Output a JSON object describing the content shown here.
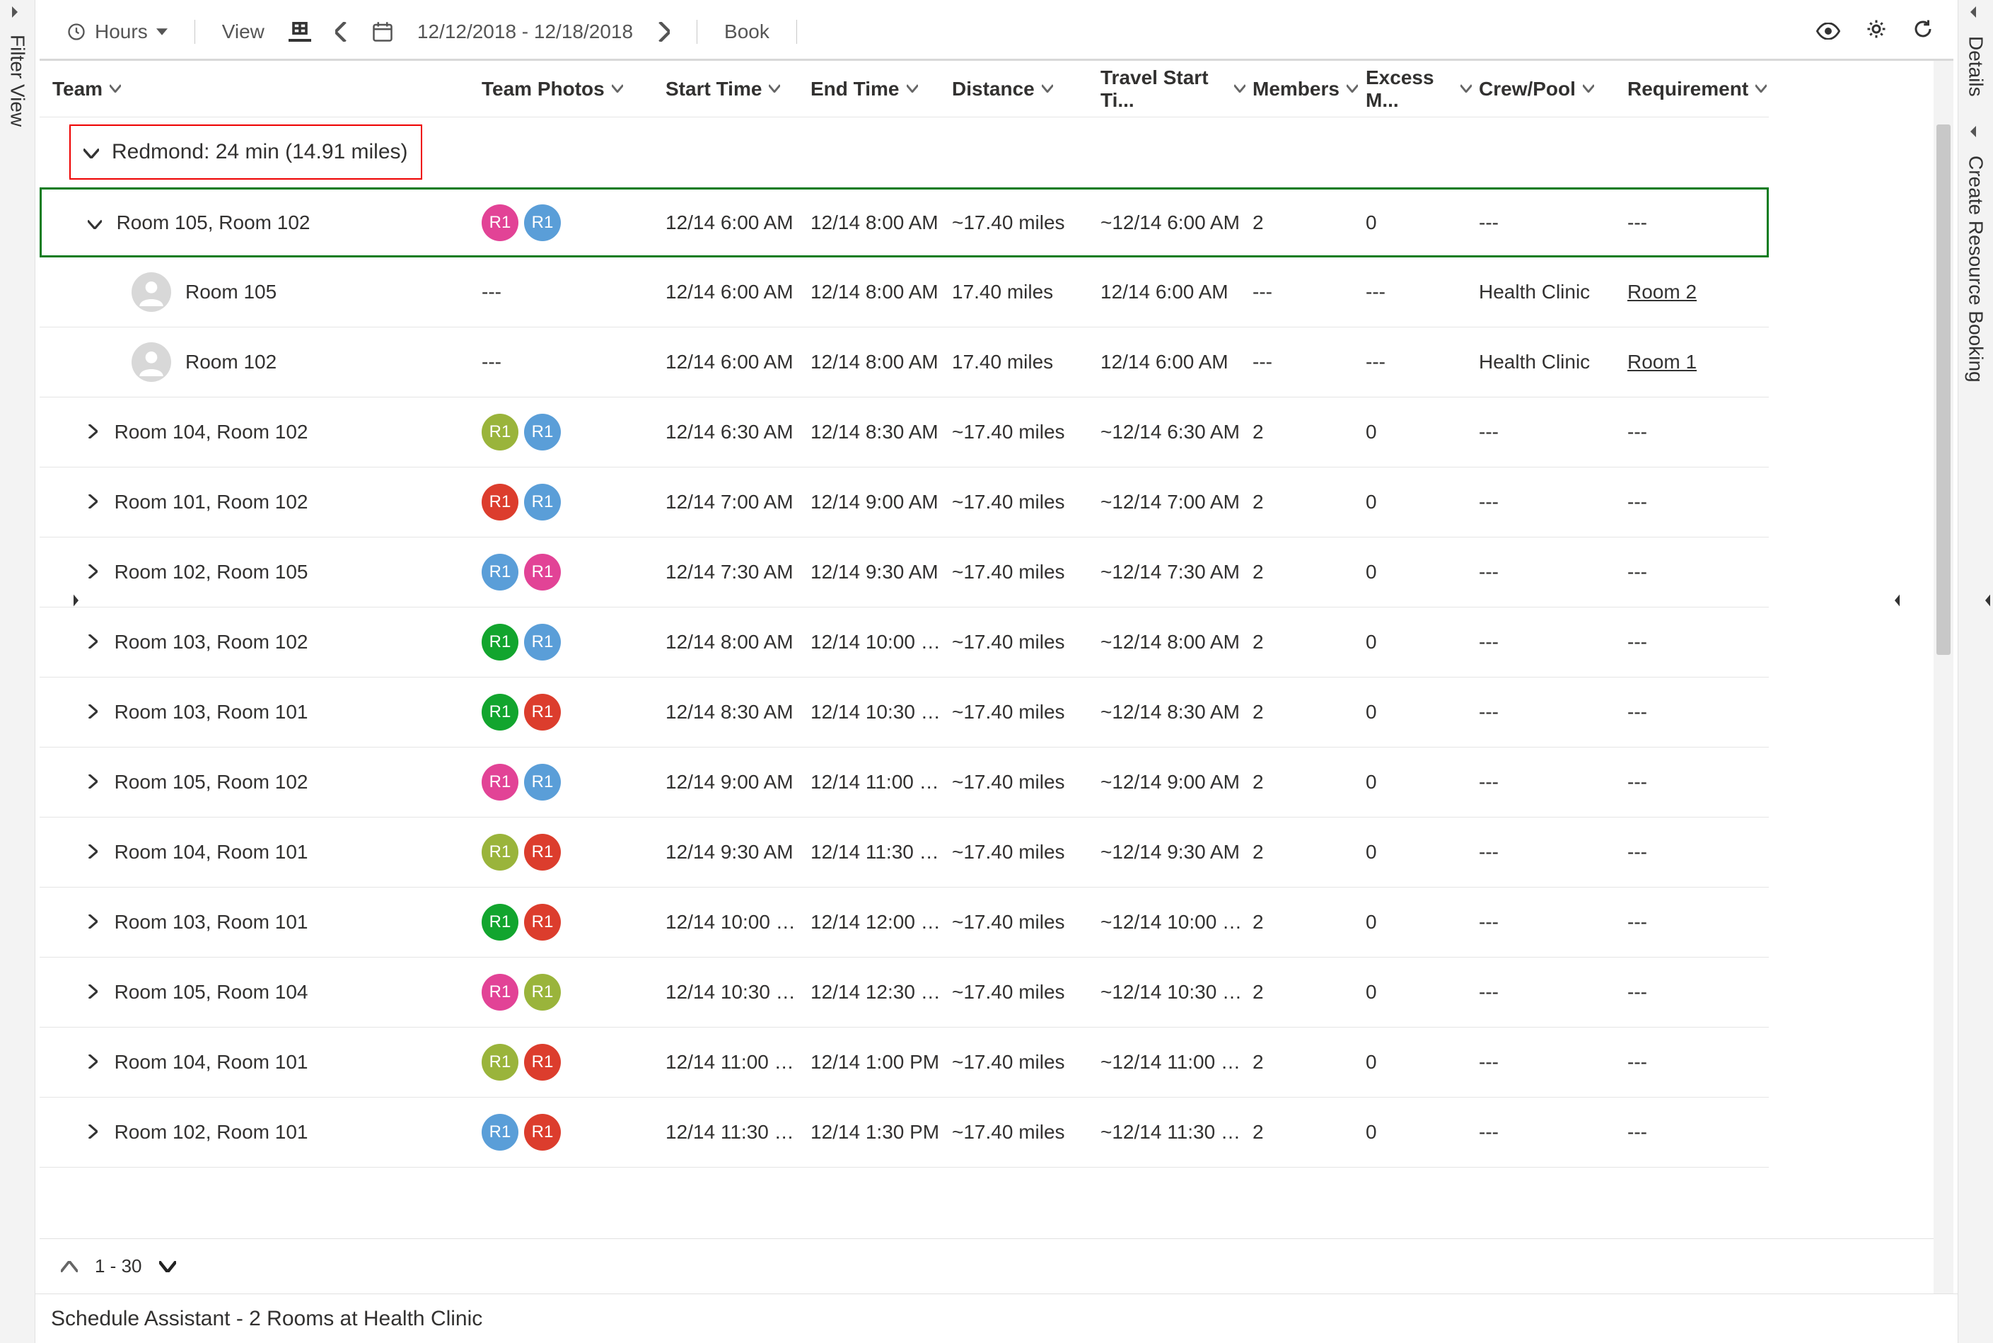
{
  "toolbar": {
    "hours": "Hours",
    "view": "View",
    "date_range": "12/12/2018 - 12/18/2018",
    "book": "Book"
  },
  "side": {
    "left": "Filter View",
    "right_top": "Details",
    "right_bottom": "Create Resource Booking"
  },
  "columns": [
    "Team",
    "Team Photos",
    "Start Time",
    "End Time",
    "Distance",
    "Travel Start Ti...",
    "Members",
    "Excess M...",
    "Crew/Pool",
    "Requirement"
  ],
  "group": {
    "label": "Redmond: 24 min (14.91 miles)"
  },
  "rows": [
    {
      "type": "team",
      "expanded": true,
      "highlight": true,
      "indent": 1,
      "name": "Room 105, Room 102",
      "badges": [
        {
          "c": "pink",
          "t": "R1"
        },
        {
          "c": "blue",
          "t": "R1"
        }
      ],
      "start": "12/14 6:00 AM",
      "end": "12/14 8:00 AM",
      "dist": "~17.40 miles",
      "tstart": "~12/14 6:00 AM",
      "members": "2",
      "excess": "0",
      "crew": "---",
      "req": "---"
    },
    {
      "type": "res",
      "indent": 2,
      "name": "Room 105",
      "photo": "---",
      "start": "12/14 6:00 AM",
      "end": "12/14 8:00 AM",
      "dist": "17.40 miles",
      "tstart": "12/14 6:00 AM",
      "members": "---",
      "excess": "---",
      "crew": "Health Clinic",
      "req": "Room 2"
    },
    {
      "type": "res",
      "indent": 2,
      "name": "Room 102",
      "photo": "---",
      "start": "12/14 6:00 AM",
      "end": "12/14 8:00 AM",
      "dist": "17.40 miles",
      "tstart": "12/14 6:00 AM",
      "members": "---",
      "excess": "---",
      "crew": "Health Clinic",
      "req": "Room 1"
    },
    {
      "type": "team",
      "indent": 1,
      "name": "Room 104, Room 102",
      "badges": [
        {
          "c": "olive",
          "t": "R1"
        },
        {
          "c": "blue",
          "t": "R1"
        }
      ],
      "start": "12/14 6:30 AM",
      "end": "12/14 8:30 AM",
      "dist": "~17.40 miles",
      "tstart": "~12/14 6:30 AM",
      "members": "2",
      "excess": "0",
      "crew": "---",
      "req": "---"
    },
    {
      "type": "team",
      "indent": 1,
      "name": "Room 101, Room 102",
      "badges": [
        {
          "c": "dred",
          "t": "R1"
        },
        {
          "c": "blue",
          "t": "R1"
        }
      ],
      "start": "12/14 7:00 AM",
      "end": "12/14 9:00 AM",
      "dist": "~17.40 miles",
      "tstart": "~12/14 7:00 AM",
      "members": "2",
      "excess": "0",
      "crew": "---",
      "req": "---"
    },
    {
      "type": "team",
      "indent": 1,
      "name": "Room 102, Room 105",
      "badges": [
        {
          "c": "blue",
          "t": "R1"
        },
        {
          "c": "pink",
          "t": "R1"
        }
      ],
      "start": "12/14 7:30 AM",
      "end": "12/14 9:30 AM",
      "dist": "~17.40 miles",
      "tstart": "~12/14 7:30 AM",
      "members": "2",
      "excess": "0",
      "crew": "---",
      "req": "---"
    },
    {
      "type": "team",
      "indent": 1,
      "name": "Room 103, Room 102",
      "badges": [
        {
          "c": "green",
          "t": "R1"
        },
        {
          "c": "blue",
          "t": "R1"
        }
      ],
      "start": "12/14 8:00 AM",
      "end": "12/14 10:00 …",
      "dist": "~17.40 miles",
      "tstart": "~12/14 8:00 AM",
      "members": "2",
      "excess": "0",
      "crew": "---",
      "req": "---"
    },
    {
      "type": "team",
      "indent": 1,
      "name": "Room 103, Room 101",
      "badges": [
        {
          "c": "green",
          "t": "R1"
        },
        {
          "c": "dred",
          "t": "R1"
        }
      ],
      "start": "12/14 8:30 AM",
      "end": "12/14 10:30 …",
      "dist": "~17.40 miles",
      "tstart": "~12/14 8:30 AM",
      "members": "2",
      "excess": "0",
      "crew": "---",
      "req": "---"
    },
    {
      "type": "team",
      "indent": 1,
      "name": "Room 105, Room 102",
      "badges": [
        {
          "c": "pink",
          "t": "R1"
        },
        {
          "c": "blue",
          "t": "R1"
        }
      ],
      "start": "12/14 9:00 AM",
      "end": "12/14 11:00 …",
      "dist": "~17.40 miles",
      "tstart": "~12/14 9:00 AM",
      "members": "2",
      "excess": "0",
      "crew": "---",
      "req": "---"
    },
    {
      "type": "team",
      "indent": 1,
      "name": "Room 104, Room 101",
      "badges": [
        {
          "c": "olive",
          "t": "R1"
        },
        {
          "c": "dred",
          "t": "R1"
        }
      ],
      "start": "12/14 9:30 AM",
      "end": "12/14 11:30 …",
      "dist": "~17.40 miles",
      "tstart": "~12/14 9:30 AM",
      "members": "2",
      "excess": "0",
      "crew": "---",
      "req": "---"
    },
    {
      "type": "team",
      "indent": 1,
      "name": "Room 103, Room 101",
      "badges": [
        {
          "c": "green",
          "t": "R1"
        },
        {
          "c": "dred",
          "t": "R1"
        }
      ],
      "start": "12/14 10:00 …",
      "end": "12/14 12:00 …",
      "dist": "~17.40 miles",
      "tstart": "~12/14 10:00 …",
      "members": "2",
      "excess": "0",
      "crew": "---",
      "req": "---"
    },
    {
      "type": "team",
      "indent": 1,
      "name": "Room 105, Room 104",
      "badges": [
        {
          "c": "pink",
          "t": "R1"
        },
        {
          "c": "olive",
          "t": "R1"
        }
      ],
      "start": "12/14 10:30 …",
      "end": "12/14 12:30 …",
      "dist": "~17.40 miles",
      "tstart": "~12/14 10:30 …",
      "members": "2",
      "excess": "0",
      "crew": "---",
      "req": "---"
    },
    {
      "type": "team",
      "indent": 1,
      "name": "Room 104, Room 101",
      "badges": [
        {
          "c": "olive",
          "t": "R1"
        },
        {
          "c": "dred",
          "t": "R1"
        }
      ],
      "start": "12/14 11:00 …",
      "end": "12/14 1:00 PM",
      "dist": "~17.40 miles",
      "tstart": "~12/14 11:00 …",
      "members": "2",
      "excess": "0",
      "crew": "---",
      "req": "---"
    },
    {
      "type": "team",
      "indent": 1,
      "name": "Room 102, Room 101",
      "badges": [
        {
          "c": "blue",
          "t": "R1"
        },
        {
          "c": "dred",
          "t": "R1"
        }
      ],
      "start": "12/14 11:30 …",
      "end": "12/14 1:30 PM",
      "dist": "~17.40 miles",
      "tstart": "~12/14 11:30 …",
      "members": "2",
      "excess": "0",
      "crew": "---",
      "req": "---"
    }
  ],
  "pager": {
    "range": "1 - 30"
  },
  "footer": {
    "title": "Schedule Assistant - 2 Rooms at Health Clinic"
  }
}
